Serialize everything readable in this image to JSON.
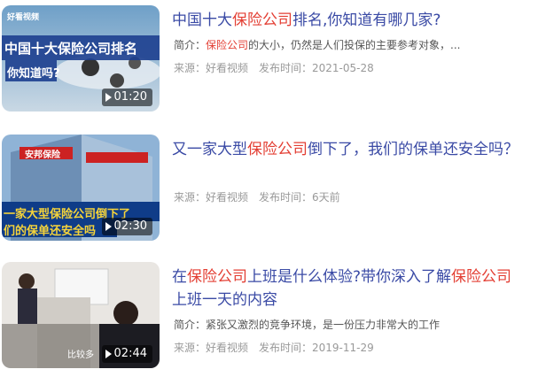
{
  "items": [
    {
      "title_parts": [
        "中国十大",
        "保险公司",
        "排名,你知道有哪几家?"
      ],
      "desc_prefix": "简介：",
      "desc_parts": [
        "保险公司",
        "的大小，仍然是人们投保的主要参考对象，..."
      ],
      "source": "来源：好看视频",
      "published": "发布时间：2021-05-28",
      "duration": "01:20",
      "thumb_text_1": "中国十大保险公司排名",
      "thumb_text_2": "你知道吗?",
      "thumb_logo": "好看视频"
    },
    {
      "title_parts": [
        "又一家大型",
        "保险公司",
        "倒下了，我们的保单还安全吗？"
      ],
      "source": "来源：好看视频",
      "published": "发布时间：6天前",
      "duration": "02:30",
      "thumb_text_1": "一家大型保险公司倒下了",
      "thumb_text_2": "们的保单还安全吗",
      "thumb_sign": "安邦保险"
    },
    {
      "title_parts": [
        "在",
        "保险公司",
        "上班是什么体验?带你深入了解",
        "保险公司",
        "上班一天的内容"
      ],
      "desc_prefix": "简介：",
      "desc_text": "紧张又激烈的竞争环境，是一份压力非常大的工作",
      "source": "来源：好看视频",
      "published": "发布时间：2019-11-29",
      "duration": "02:44",
      "thumb_caption": "比较多"
    }
  ],
  "colors": {
    "title": "#3a4aa5",
    "highlight": "#e33e33",
    "meta": "#999999"
  }
}
